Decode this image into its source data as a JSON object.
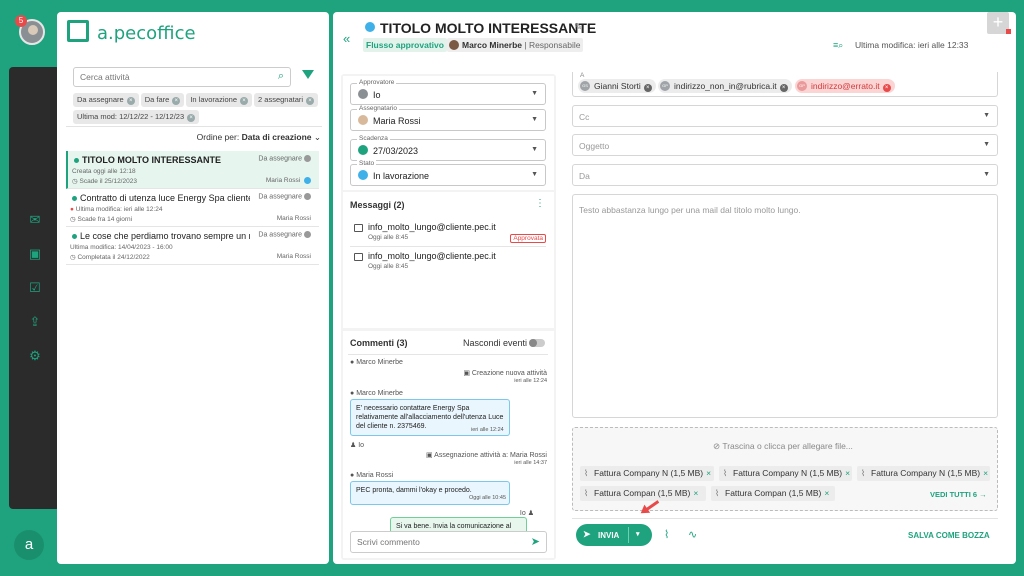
{
  "user": {
    "notifications": "5"
  },
  "app": {
    "logo_text": "a.pecoffice",
    "logo_letter": "a"
  },
  "search": {
    "placeholder": "Cerca attività"
  },
  "filters": [
    "Da assegnare",
    "Da fare",
    "In lavorazione",
    "2 assegnatari",
    "Ultima mod: 12/12/22 - 12/12/23"
  ],
  "sort": {
    "label": "Ordine per:",
    "value": "Data di creazione"
  },
  "tasks": [
    {
      "title": "TITOLO MOLTO INTERESSANTE",
      "status": "Da assegnare",
      "line1": "Creata oggi alle 12:18",
      "line2": "Scade il 25/12/2023",
      "assignee": "Maria Rossi"
    },
    {
      "title": "Contratto di utenza luce Energy Spa cliente...",
      "status": "Da assegnare",
      "line1": "Ultima modifica: ieri alle 12:24",
      "line2": "Scade fra 14 giorni",
      "assignee": "Maria Rossi"
    },
    {
      "title": "Le cose che perdiamo trovano sempre un m...",
      "status": "Da assegnare",
      "line1": "Ultima modifica: 14/04/2023 - 16:00",
      "line2": "Completata il 24/12/2022",
      "assignee": "Maria Rossi"
    }
  ],
  "detail": {
    "title": "TITOLO MOLTO INTERESSANTE",
    "flow": "Flusso approvativo",
    "owner": "Marco Minerbe",
    "owner_role": "| Responsabile",
    "last_modified": "Ultima modifica: ieri alle 12:33"
  },
  "fields": [
    {
      "label": "Approvatore",
      "value": "Io"
    },
    {
      "label": "Assegnatario",
      "value": "Maria Rossi"
    },
    {
      "label": "Scadenza",
      "value": "27/03/2023"
    },
    {
      "label": "Stato",
      "value": "In lavorazione"
    }
  ],
  "messages": {
    "title": "Messaggi (2)",
    "items": [
      {
        "address": "info_molto_lungo@cliente.pec.it",
        "time": "Oggi alle 8:45",
        "tag": "Approvata"
      },
      {
        "address": "info_molto_lungo@cliente.pec.it",
        "time": "Oggi alle 8:45",
        "tag": ""
      }
    ]
  },
  "comments": {
    "title": "Commenti (3)",
    "hide_events": "Nascondi eventi",
    "entries": [
      {
        "author": "Marco Minerbe",
        "event": "Creazione nuova attività",
        "time": "ieri alle 12:24"
      },
      {
        "author": "Marco Minerbe",
        "text": "E' necessario contattare Energy Spa relativamente all'allacciamento dell'utenza Luce del cliente n. 2375469.",
        "time": "ieri alle 12:24"
      },
      {
        "author": "Io",
        "event": "Assegnazione attività a: Maria Rossi",
        "time": "ieri alle 14:37"
      },
      {
        "author": "Maria Rossi",
        "text": "PEC pronta, dammi l'okay e procedo.",
        "time": "Oggi alle 10:45"
      },
      {
        "author": "Io",
        "text": "Si va bene. Invia la comunicazione al cliente e...",
        "time": ""
      }
    ],
    "placeholder": "Scrivi commento"
  },
  "mail": {
    "to_label": "A",
    "recipients": [
      {
        "initials": "GS",
        "name": "Gianni Storti",
        "error": false
      },
      {
        "initials": "GP",
        "name": "indirizzo_non_in@rubrica.it",
        "error": false
      },
      {
        "initials": "GP",
        "name": "indirizzo@errato.it",
        "error": true
      }
    ],
    "cc": "Cc",
    "subject": "Oggetto",
    "from": "Da",
    "body": "Testo abbastanza lungo per una mail dal titolo molto lungo.",
    "drop_label": "Trascina o clicca per allegare file...",
    "attachments": [
      {
        "name": "Fattura Company N",
        "size": "(1,5 MB)"
      },
      {
        "name": "Fattura Company N",
        "size": "(1,5 MB)"
      },
      {
        "name": "Fattura Company N",
        "size": "(1,5 MB)"
      },
      {
        "name": "Fattura Compan",
        "size": "(1,5 MB)"
      },
      {
        "name": "Fattura Compan",
        "size": "(1,5 MB)"
      }
    ],
    "see_all": "VEDI TUTTI 6",
    "send": "INVIA",
    "save_draft": "SALVA COME BOZZA"
  },
  "colors": {
    "brand": "#1fa37e",
    "error": "#e84a4a",
    "info": "#3fb0e8"
  }
}
